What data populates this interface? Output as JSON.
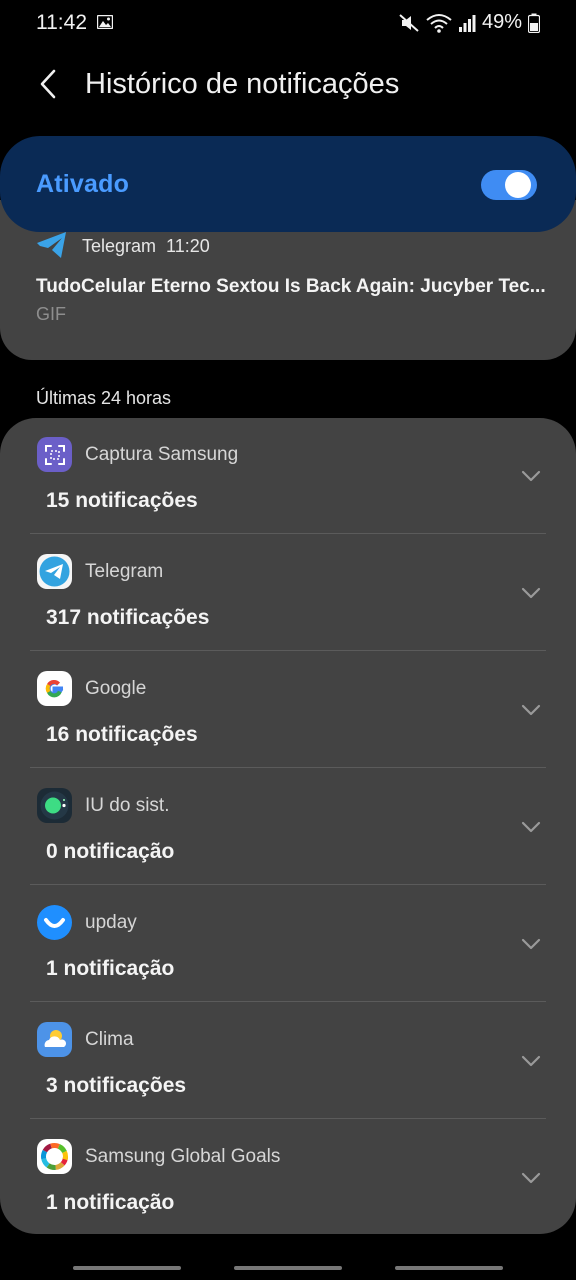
{
  "status": {
    "time": "11:42",
    "battery": "49%"
  },
  "header": {
    "title": "Histórico de notificações"
  },
  "toggle": {
    "label": "Ativado",
    "on": true
  },
  "recent_notification": {
    "app": "Telegram",
    "time": "11:20",
    "title": "TudoCelular Eterno Sextou Is Back Again: Jucyber Tec...",
    "subtitle": "GIF"
  },
  "section": {
    "label": "Últimas 24 horas"
  },
  "apps": [
    {
      "name": "Captura Samsung",
      "count": "15 notificações",
      "icon": "screen-capture-icon"
    },
    {
      "name": "Telegram",
      "count": "317 notificações",
      "icon": "telegram-icon"
    },
    {
      "name": "Google",
      "count": "16 notificações",
      "icon": "google-icon"
    },
    {
      "name": "IU do sist.",
      "count": "0 notificação",
      "icon": "system-ui-icon"
    },
    {
      "name": "upday",
      "count": "1 notificação",
      "icon": "upday-icon"
    },
    {
      "name": "Clima",
      "count": "3 notificações",
      "icon": "weather-icon"
    },
    {
      "name": "Samsung Global Goals",
      "count": "1 notificação",
      "icon": "global-goals-icon"
    }
  ],
  "colors": {
    "background": "#000000",
    "card": "#434343",
    "toggle_bar": "#0a2a55",
    "accent": "#4a9bff"
  }
}
